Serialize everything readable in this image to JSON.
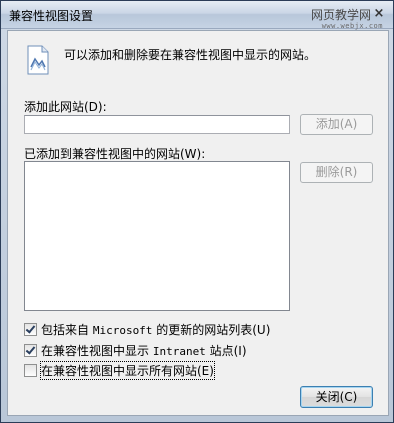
{
  "window": {
    "title": "兼容性视图设置",
    "close_symbol": "×"
  },
  "watermark": {
    "main": "网页教学网",
    "sub": "www.webjx.com"
  },
  "info": {
    "icon": "compatibility-view-icon",
    "text": "可以添加和删除要在兼容性视图中显示的网站。"
  },
  "add_site": {
    "label": "添加此网站(D):",
    "input_value": "",
    "add_button": "添加(A)"
  },
  "sites_list": {
    "label": "已添加到兼容性视图中的网站(W):",
    "items": [],
    "remove_button": "删除(R)"
  },
  "options": [
    {
      "prefix": "包括来自 ",
      "mono": "Microsoft",
      "suffix": " 的更新的网站列表(U)",
      "checked": true
    },
    {
      "prefix": "在兼容性视图中显示 ",
      "mono": "Intranet",
      "suffix": " 站点(I)",
      "checked": true
    },
    {
      "prefix": "在兼容性视图中显示所有网站(E)",
      "mono": "",
      "suffix": "",
      "checked": false
    }
  ],
  "footer": {
    "close_button": "关闭(C)"
  }
}
